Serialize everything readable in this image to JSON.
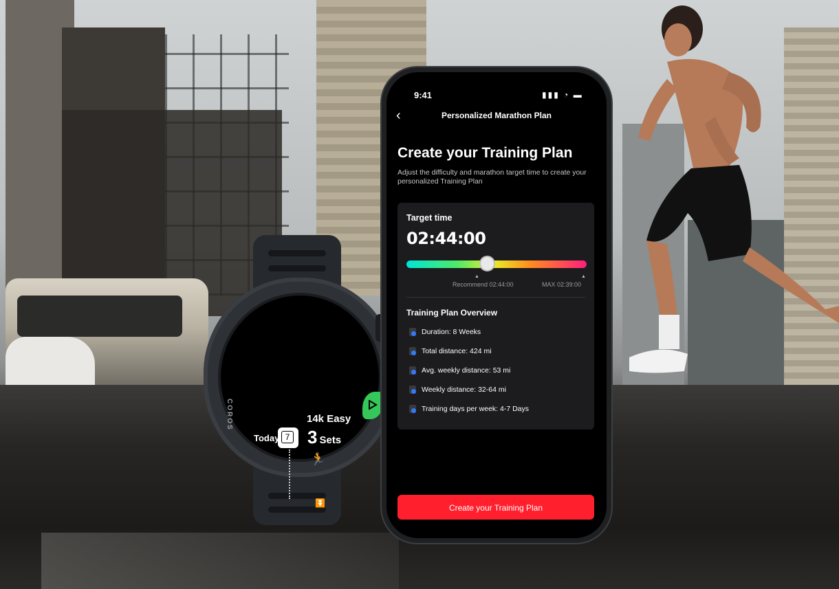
{
  "watch": {
    "brand": "COROS",
    "today_label": "Today",
    "date": "7",
    "workout": "14k Easy",
    "sets_count": "3",
    "sets_label": "Sets",
    "run_icon": "runner-icon",
    "play_icon": "play-icon",
    "more_icon": "chevron-double-down-icon"
  },
  "phone": {
    "status_time": "9:41",
    "status_icons": [
      "signal-icon",
      "wifi-icon",
      "battery-icon"
    ],
    "nav": {
      "back_icon": "chevron-left-icon",
      "title": "Personalized Marathon Plan"
    },
    "heading": "Create your Training Plan",
    "subheading": "Adjust the difficulty and marathon target time to create your personalized Training Plan",
    "target": {
      "label": "Target time",
      "value": "02:44:00",
      "slider_position": 0.45,
      "recommend_label": "Recommend 02:44:00",
      "max_label": "MAX 02:39:00"
    },
    "overview": {
      "title": "Training Plan Overview",
      "items": [
        "Duration: 8 Weeks",
        "Total distance: 424 mi",
        "Avg. weekly distance: 53 mi",
        "Weekly distance: 32-64 mi",
        "Training days per week: 4-7 Days"
      ]
    },
    "cta_label": "Create your Training Plan",
    "accent_color": "#ff1f2d"
  }
}
